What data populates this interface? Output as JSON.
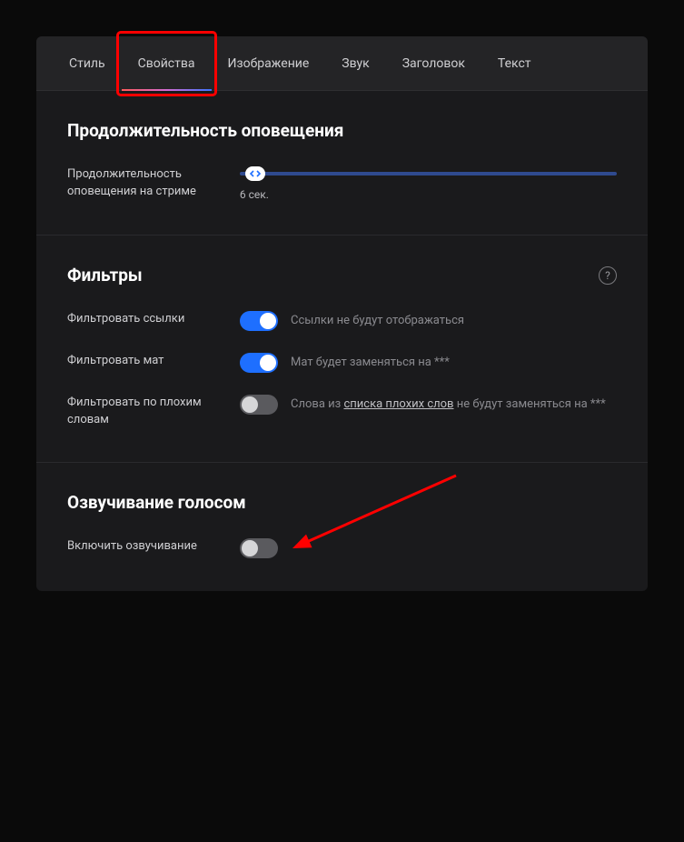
{
  "tabs": [
    {
      "label": "Стиль"
    },
    {
      "label": "Свойства"
    },
    {
      "label": "Изображение"
    },
    {
      "label": "Звук"
    },
    {
      "label": "Заголовок"
    },
    {
      "label": "Текст"
    }
  ],
  "active_tab_index": 1,
  "duration_section": {
    "title": "Продолжительность оповещения",
    "label": "Продолжительность оповещения на стриме",
    "value_text": "6 сек.",
    "slider_percent": 4
  },
  "filters_section": {
    "title": "Фильтры",
    "rows": [
      {
        "label": "Фильтровать ссылки",
        "toggle": true,
        "desc_plain": "Ссылки не будут отображаться"
      },
      {
        "label": "Фильтровать мат",
        "toggle": true,
        "desc_plain": "Мат будет заменяться на ***"
      },
      {
        "label": "Фильтровать по плохим словам",
        "toggle": false,
        "desc_pre": "Слова из ",
        "desc_link": "списка плохих слов",
        "desc_post": " не будут заменяться на ***"
      }
    ]
  },
  "voice_section": {
    "title": "Озвучивание голосом",
    "row_label": "Включить озвучивание",
    "toggle": false
  },
  "annotations": {
    "highlight_tab_index": 1,
    "arrow_target": "enable-voice-toggle"
  }
}
